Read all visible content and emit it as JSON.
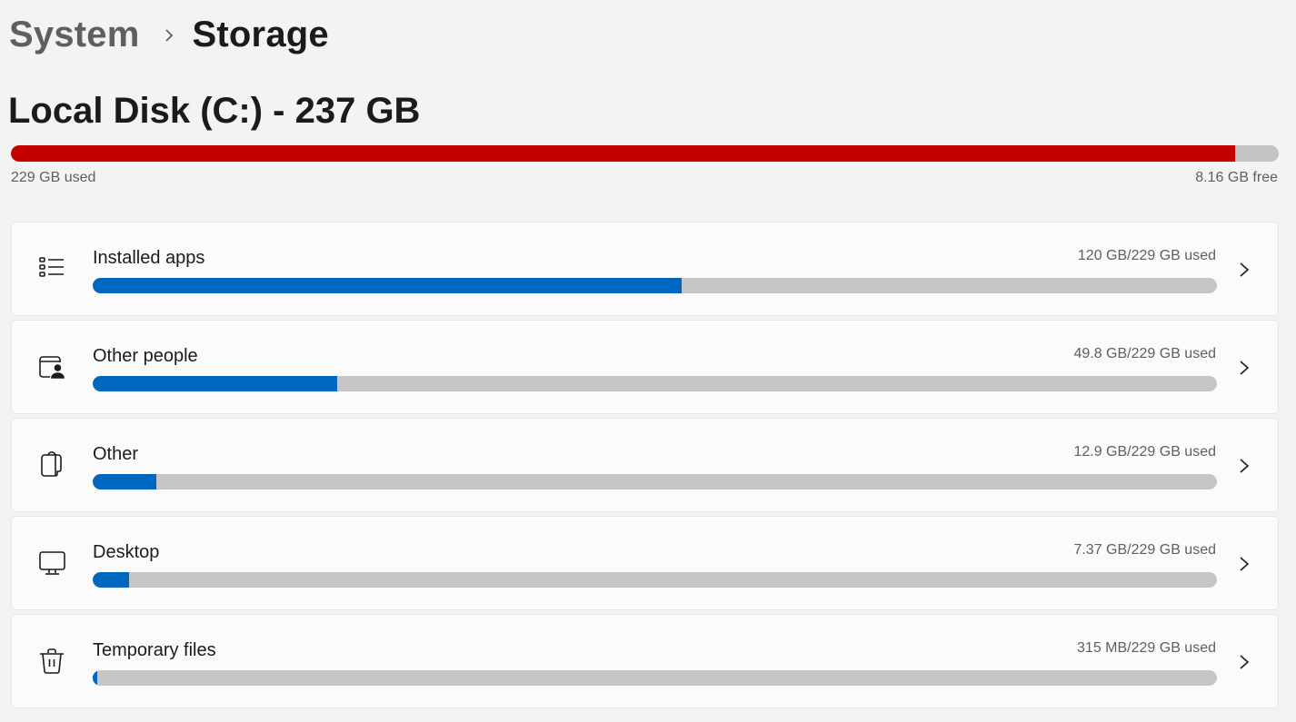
{
  "breadcrumb": {
    "parent": "System",
    "separator_icon": "chevron-right-icon",
    "current": "Storage"
  },
  "disk": {
    "title": "Local Disk (C:) - 237 GB",
    "used_label": "229 GB used",
    "free_label": "8.16 GB free",
    "used_fraction": 0.9656,
    "bar_color": "#c40000"
  },
  "categories": [
    {
      "label": "Installed apps",
      "usage": "120 GB/229 GB used",
      "fraction": 0.524,
      "icon": "apps-list-icon"
    },
    {
      "label": "Other people",
      "usage": "49.8 GB/229 GB used",
      "fraction": 0.2175,
      "icon": "other-people-icon"
    },
    {
      "label": "Other",
      "usage": "12.9 GB/229 GB used",
      "fraction": 0.0563,
      "icon": "other-files-icon"
    },
    {
      "label": "Desktop",
      "usage": "7.37 GB/229 GB used",
      "fraction": 0.0322,
      "icon": "desktop-icon"
    },
    {
      "label": "Temporary files",
      "usage": "315 MB/229 GB used",
      "fraction": 0.0014,
      "icon": "trash-icon"
    }
  ],
  "colors": {
    "accent": "#0067c0",
    "track": "#c6c6c6",
    "disk_critical": "#c40000"
  }
}
